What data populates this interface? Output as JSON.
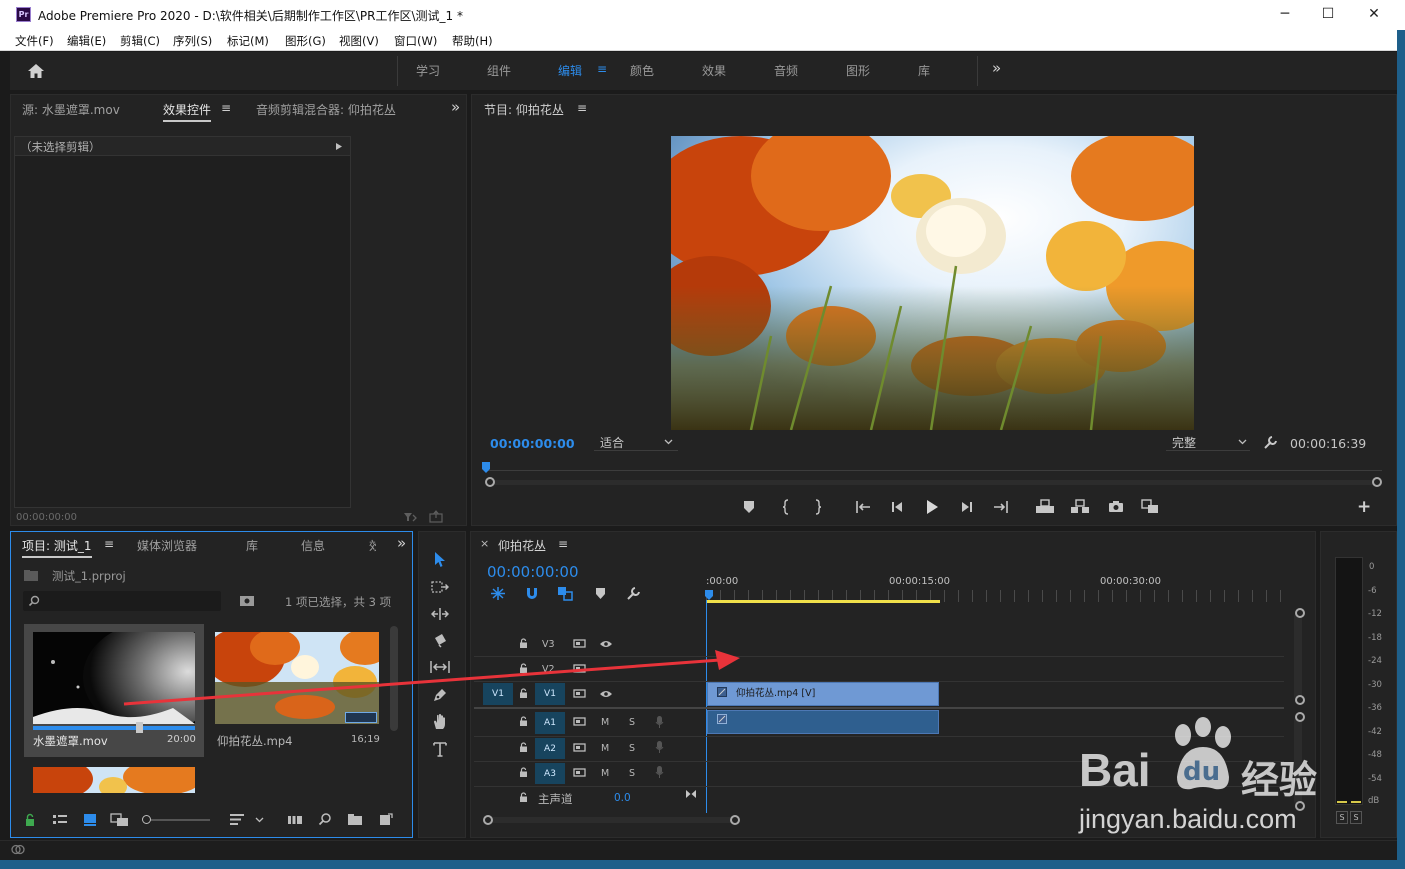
{
  "window": {
    "app_icon": "Pr",
    "title": "Adobe Premiere Pro 2020 - D:\\软件相关\\后期制作工作区\\PR工作区\\测试_1 *",
    "minimize_glyph": "─",
    "maximize_glyph": "☐",
    "close_glyph": "✕"
  },
  "menu": [
    "文件(F)",
    "编辑(E)",
    "剪辑(C)",
    "序列(S)",
    "标记(M)",
    "图形(G)",
    "视图(V)",
    "窗口(W)",
    "帮助(H)"
  ],
  "workspaces": {
    "tabs": [
      "学习",
      "组件",
      "编辑",
      "颜色",
      "效果",
      "音频",
      "图形",
      "库"
    ],
    "active": "编辑",
    "menu_glyph": "≡",
    "overflow_glyph": "»"
  },
  "source_panel": {
    "tabs": [
      "源: 水墨遮罩.mov",
      "效果控件",
      "音频剪辑混合器: 仰拍花丛"
    ],
    "active_tab": "效果控件",
    "no_clip_text": "（未选择剪辑）",
    "timecode": "00:00:00:00"
  },
  "program_monitor": {
    "title": "节目: 仰拍花丛",
    "timecode": "00:00:00:00",
    "fit": "适合",
    "quality": "完整",
    "duration": "00:00:16:39",
    "add_glyph": "+"
  },
  "project_panel": {
    "tabs": [
      "项目: 测试_1",
      "媒体浏览器",
      "库",
      "信息",
      "效"
    ],
    "project_file": "测试_1.prproj",
    "selection_status": "1 项已选择，共 3 项",
    "items": [
      {
        "name": "水墨遮罩.mov",
        "duration": "20:00"
      },
      {
        "name": "仰拍花丛.mp4",
        "duration": "16;19"
      }
    ]
  },
  "timeline": {
    "close_glyph": "×",
    "title": "仰拍花丛",
    "timecode": "00:00:00:00",
    "ruler": [
      ":00:00",
      "00:00:15:00",
      "00:00:30:00"
    ],
    "video_tracks": [
      "V3",
      "V2",
      "V1"
    ],
    "audio_tracks": [
      "A1",
      "A2",
      "A3"
    ],
    "source_patch": "V1",
    "mute_label": "M",
    "solo_label": "S",
    "master_label": "主声道",
    "master_value": "0.0",
    "clip_label": "仰拍花丛.mp4 [V]",
    "clip_icon_glyph": "fx"
  },
  "audio_meter": {
    "scale": [
      "0",
      "-6",
      "-12",
      "-18",
      "-24",
      "-30",
      "-36",
      "-42",
      "-48",
      "-54",
      "dB"
    ],
    "solo_buttons": [
      "S",
      "S"
    ]
  },
  "watermark": {
    "brand": "Bai",
    "brand_suffix": "du",
    "cn": "经验",
    "url": "jingyan.baidu.com"
  },
  "colors": {
    "accent": "#2d8ceb",
    "clip": "#6f99d4",
    "work_area": "#f0e04a",
    "arrow": "#e8333a"
  }
}
